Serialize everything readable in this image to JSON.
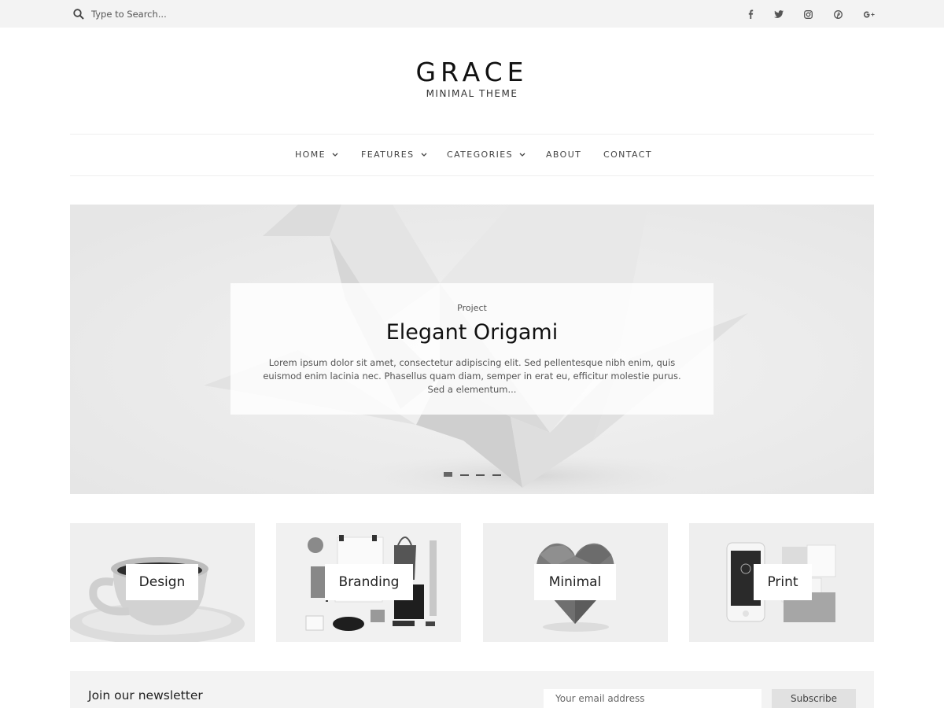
{
  "search": {
    "placeholder": "Type to Search..."
  },
  "social": [
    {
      "name": "facebook-icon",
      "glyph": "f"
    },
    {
      "name": "twitter-icon",
      "glyph": "t"
    },
    {
      "name": "instagram-icon",
      "glyph": "i"
    },
    {
      "name": "pinterest-icon",
      "glyph": "p"
    },
    {
      "name": "google-plus-icon",
      "glyph": "G+"
    }
  ],
  "branding": {
    "title": "GRACE",
    "subtitle": "MINIMAL THEME"
  },
  "nav": {
    "items": [
      {
        "label": "HOME",
        "has_dropdown": true
      },
      {
        "label": "FEATURES",
        "has_dropdown": true
      },
      {
        "label": "CATEGORIES",
        "has_dropdown": true
      },
      {
        "label": "ABOUT",
        "has_dropdown": false
      },
      {
        "label": "CONTACT",
        "has_dropdown": false
      }
    ]
  },
  "hero": {
    "category": "Project",
    "title": "Elegant Origami",
    "excerpt": "Lorem ipsum dolor sit amet, consectetur adipiscing elit. Sed pellentesque nibh enim, quis euismod enim lacinia nec. Phasellus quam diam, semper in erat eu, efficitur molestie purus. Sed a elementum...",
    "slides": 4,
    "active_slide": 1
  },
  "categories": [
    {
      "label": "Design"
    },
    {
      "label": "Branding"
    },
    {
      "label": "Minimal"
    },
    {
      "label": "Print"
    }
  ],
  "newsletter": {
    "title": "Join our newsletter",
    "placeholder": "Your email address",
    "button": "Subscribe"
  },
  "colors": {
    "topbar_bg": "#f3f3f3",
    "tile_bg": "#efefef",
    "text": "#222222"
  }
}
